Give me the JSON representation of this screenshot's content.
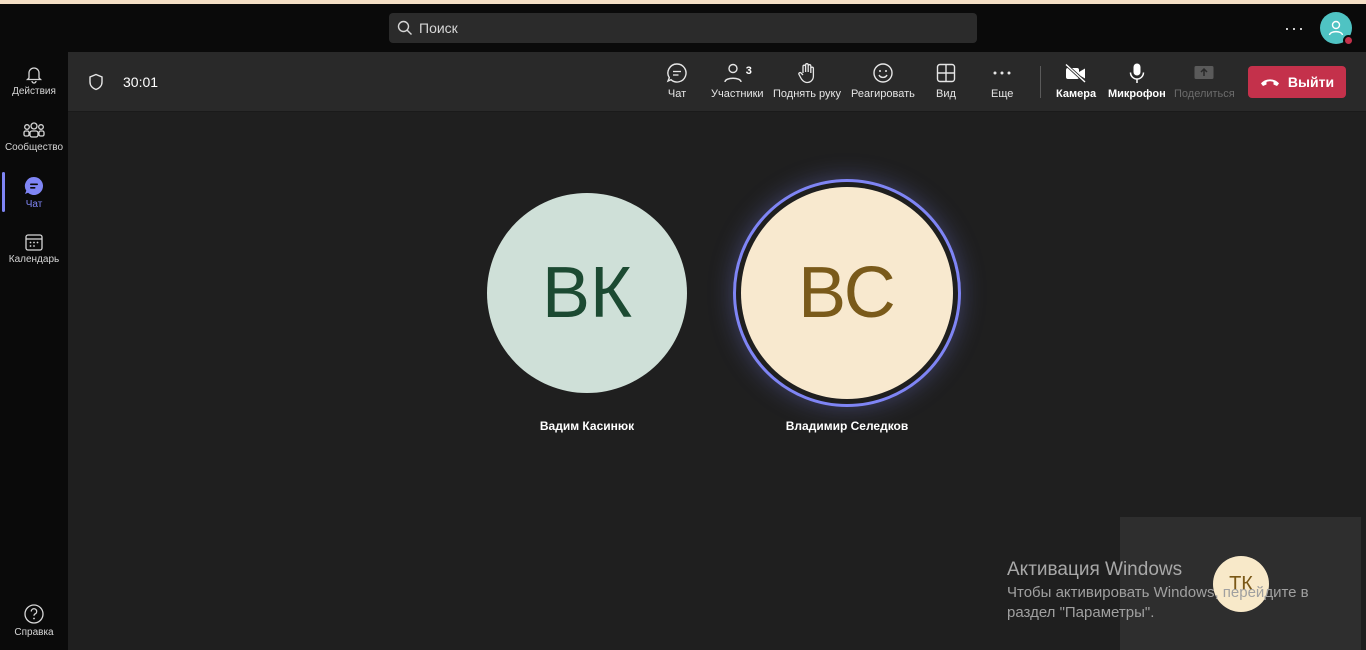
{
  "search": {
    "placeholder": "Поиск"
  },
  "titlebar": {
    "more": "···"
  },
  "rail": {
    "items": [
      {
        "label": "Действия",
        "icon": "bell-icon"
      },
      {
        "label": "Сообщество",
        "icon": "community-icon"
      },
      {
        "label": "Чат",
        "icon": "chat-icon",
        "active": true
      },
      {
        "label": "Календарь",
        "icon": "calendar-icon"
      }
    ],
    "help": "Справка"
  },
  "meeting": {
    "timer": "30:01",
    "participants_count": "3",
    "buttons": {
      "chat": "Чат",
      "participants": "Участники",
      "raise_hand": "Поднять руку",
      "react": "Реагировать",
      "view": "Вид",
      "more": "Еще",
      "camera": "Камера",
      "mic": "Микрофон",
      "share": "Поделиться",
      "leave": "Выйти"
    }
  },
  "participants": [
    {
      "initials": "ВК",
      "name": "Вадим Касинюк",
      "bg": "#cfe0d8",
      "fg": "#1c4a32"
    },
    {
      "initials": "ВС",
      "name": "Владимир Селедков",
      "bg": "#f8e9cf",
      "fg": "#7a5a1a",
      "speaking": true
    }
  ],
  "self": {
    "initials": "ТК"
  },
  "watermark": {
    "title": "Активация Windows",
    "body": "Чтобы активировать Windows, перейдите в раздел \"Параметры\"."
  },
  "colors": {
    "accent": "#7f85f5",
    "leave": "#c4314b"
  }
}
